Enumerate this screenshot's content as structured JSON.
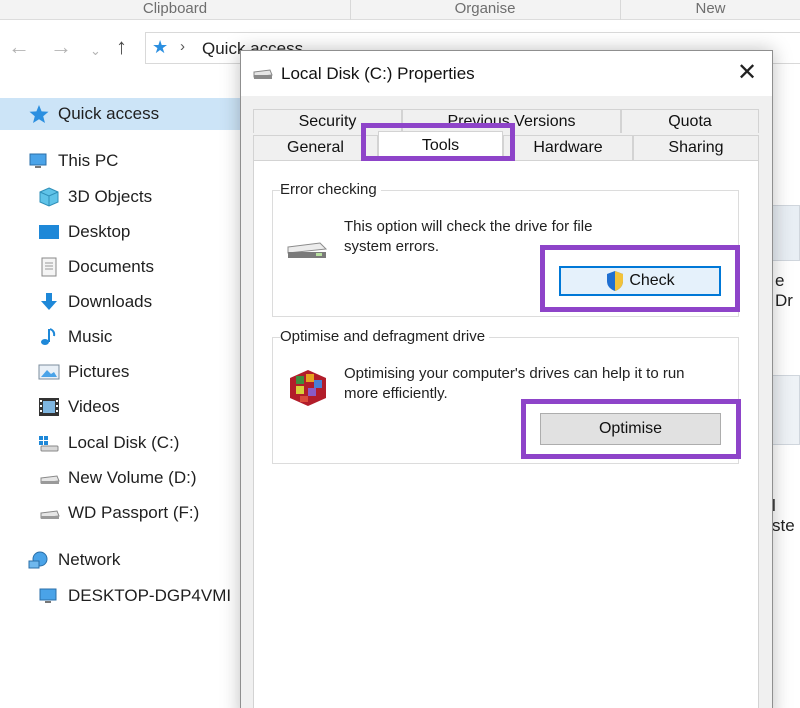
{
  "ribbon": {
    "clipboard": "Clipboard",
    "organise": "Organise",
    "new": "New"
  },
  "address": {
    "path": "Quick access"
  },
  "sidebar": {
    "items": [
      {
        "label": "Quick access",
        "icon": "star-icon"
      },
      {
        "label": "This PC",
        "icon": "computer-icon"
      },
      {
        "label": "3D Objects",
        "icon": "3d-objects-icon"
      },
      {
        "label": "Desktop",
        "icon": "desktop-icon"
      },
      {
        "label": "Documents",
        "icon": "documents-icon"
      },
      {
        "label": "Downloads",
        "icon": "downloads-icon"
      },
      {
        "label": "Music",
        "icon": "music-icon"
      },
      {
        "label": "Pictures",
        "icon": "pictures-icon"
      },
      {
        "label": "Videos",
        "icon": "videos-icon"
      },
      {
        "label": "Local Disk (C:)",
        "icon": "windows-drive-icon"
      },
      {
        "label": "New Volume (D:)",
        "icon": "drive-icon"
      },
      {
        "label": "WD Passport (F:)",
        "icon": "drive-icon"
      },
      {
        "label": "Network",
        "icon": "network-icon"
      },
      {
        "label": "DESKTOP-DGP4VMI",
        "icon": "computer-icon"
      }
    ]
  },
  "background": {
    "edge_text_1": "e Dr",
    "edge_text_2": "l ste"
  },
  "dialog": {
    "title": "Local Disk (C:) Properties",
    "close": "✕",
    "tabs_row1": [
      "Security",
      "Previous Versions",
      "Quota"
    ],
    "tabs_row2": [
      "General",
      "Tools",
      "Hardware",
      "Sharing"
    ],
    "active_tab": "Tools",
    "error_checking": {
      "title": "Error checking",
      "line1": "This option will check the drive for file",
      "line2": "system errors.",
      "button": "Check"
    },
    "optimise": {
      "title": "Optimise and defragment drive",
      "line1": "Optimising your computer's drives can help it to run",
      "line2": "more efficiently.",
      "button": "Optimise"
    }
  },
  "colors": {
    "highlight": "#8e44c9",
    "selection": "#cce4f7",
    "accent": "#0078d7"
  }
}
